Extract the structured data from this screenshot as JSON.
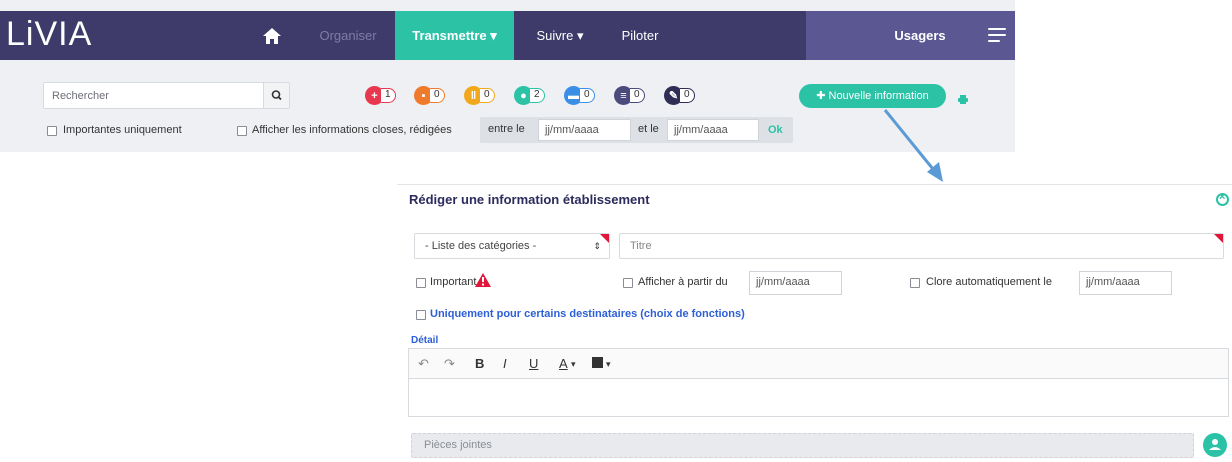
{
  "nav": {
    "logo": "LiVIA",
    "items": [
      {
        "label": "Organiser"
      },
      {
        "label": "Transmettre ▾"
      },
      {
        "label": "Suivre ▾"
      },
      {
        "label": "Piloter"
      }
    ],
    "usagers": "Usagers"
  },
  "search": {
    "placeholder": "Rechercher"
  },
  "categories": [
    {
      "icon": "medical-cross-icon",
      "count": "1",
      "color": "#e8384f"
    },
    {
      "icon": "meal-icon",
      "count": "0",
      "color": "#f07a2b"
    },
    {
      "icon": "cutlery-icon",
      "count": "0",
      "color": "#f2a81d"
    },
    {
      "icon": "group-icon",
      "count": "2",
      "color": "#2bc2a6"
    },
    {
      "icon": "bed-icon",
      "count": "0",
      "color": "#3a8ee6"
    },
    {
      "icon": "document-icon",
      "count": "0",
      "color": "#4b4a7d"
    },
    {
      "icon": "tools-icon",
      "count": "0",
      "color": "#2f2d55"
    }
  ],
  "toolbar": {
    "new_info": "Nouvelle information",
    "important_only": "Importantes uniquement",
    "show_closed": "Afficher les informations closes, rédigées",
    "between": "entre le",
    "and": "et le",
    "date_placeholder": "jj/mm/aaaa",
    "ok": "Ok"
  },
  "modal": {
    "title": "Rédiger une information établissement",
    "category_placeholder": "- Liste des catégories -",
    "title_placeholder": "Titre",
    "important": "Important",
    "show_from": "Afficher à partir du",
    "date_placeholder": "jj/mm/aaaa",
    "auto_close": "Clore automatiquement le",
    "recipients": "Uniquement pour certains destinataires (choix de fonctions)",
    "detail": "Détail",
    "attachments": "Pièces jointes",
    "editor_buttons": [
      "B",
      "I",
      "U",
      "A",
      "▾"
    ]
  },
  "colors": {
    "nav": "#3e3b6a",
    "accent": "#2bc2a6",
    "danger": "#e0173b",
    "link": "#2d5fd6"
  }
}
